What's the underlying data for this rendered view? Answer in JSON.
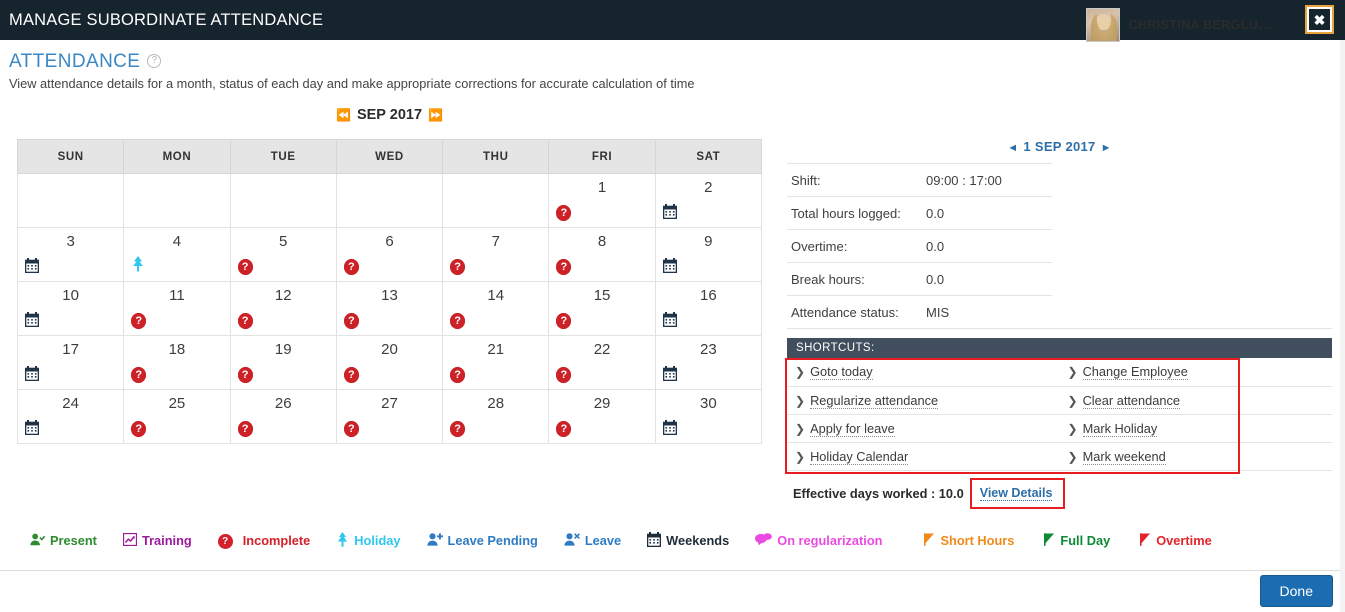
{
  "window": {
    "title": "MANAGE SUBORDINATE ATTENDANCE",
    "close_label": "✖"
  },
  "header": {
    "page_title": "ATTENDANCE",
    "help_icon": "?",
    "subtitle": "View attendance details for a month, status of each day and make appropriate corrections for accurate calculation of time",
    "user_name": "CHRISTINA BERGLU…"
  },
  "month_nav": {
    "prev": "⏪",
    "label": "SEP 2017",
    "next": "⏩"
  },
  "calendar": {
    "weekdays": [
      "SUN",
      "MON",
      "TUE",
      "WED",
      "THU",
      "FRI",
      "SAT"
    ],
    "weeks": [
      [
        {
          "day": "",
          "mark": ""
        },
        {
          "day": "",
          "mark": ""
        },
        {
          "day": "",
          "mark": ""
        },
        {
          "day": "",
          "mark": ""
        },
        {
          "day": "",
          "mark": ""
        },
        {
          "day": "1",
          "mark": "incomplete"
        },
        {
          "day": "2",
          "mark": "weekend"
        }
      ],
      [
        {
          "day": "3",
          "mark": "weekend"
        },
        {
          "day": "4",
          "mark": "holiday"
        },
        {
          "day": "5",
          "mark": "incomplete"
        },
        {
          "day": "6",
          "mark": "incomplete"
        },
        {
          "day": "7",
          "mark": "incomplete"
        },
        {
          "day": "8",
          "mark": "incomplete"
        },
        {
          "day": "9",
          "mark": "weekend"
        }
      ],
      [
        {
          "day": "10",
          "mark": "weekend"
        },
        {
          "day": "11",
          "mark": "incomplete"
        },
        {
          "day": "12",
          "mark": "incomplete"
        },
        {
          "day": "13",
          "mark": "incomplete"
        },
        {
          "day": "14",
          "mark": "incomplete"
        },
        {
          "day": "15",
          "mark": "incomplete"
        },
        {
          "day": "16",
          "mark": "weekend"
        }
      ],
      [
        {
          "day": "17",
          "mark": "weekend"
        },
        {
          "day": "18",
          "mark": "incomplete"
        },
        {
          "day": "19",
          "mark": "incomplete"
        },
        {
          "day": "20",
          "mark": "incomplete"
        },
        {
          "day": "21",
          "mark": "incomplete"
        },
        {
          "day": "22",
          "mark": "incomplete"
        },
        {
          "day": "23",
          "mark": "weekend"
        }
      ],
      [
        {
          "day": "24",
          "mark": "weekend"
        },
        {
          "day": "25",
          "mark": "incomplete"
        },
        {
          "day": "26",
          "mark": "incomplete"
        },
        {
          "day": "27",
          "mark": "incomplete"
        },
        {
          "day": "28",
          "mark": "incomplete"
        },
        {
          "day": "29",
          "mark": "incomplete"
        },
        {
          "day": "30",
          "mark": "weekend"
        }
      ]
    ]
  },
  "day_detail": {
    "prev": "◄",
    "date": "1 SEP 2017",
    "next": "►",
    "rows": [
      {
        "key": "Shift:",
        "value": "09:00 : 17:00"
      },
      {
        "key": "Total hours logged:",
        "value": "0.0"
      },
      {
        "key": "Overtime:",
        "value": "0.0"
      },
      {
        "key": "Break hours:",
        "value": "0.0"
      },
      {
        "key": "Attendance status:",
        "value": "MIS"
      }
    ]
  },
  "shortcuts": {
    "title": "SHORTCUTS:",
    "chevron": "❯",
    "rows": [
      {
        "left": "Goto today",
        "right": "Change Employee"
      },
      {
        "left": "Regularize attendance",
        "right": "Clear attendance"
      },
      {
        "left": "Apply for leave",
        "right": "Mark Holiday"
      },
      {
        "left": "Holiday Calendar",
        "right": "Mark weekend"
      }
    ]
  },
  "effective": {
    "text": "Effective days worked : 10.0",
    "view_details": "View Details"
  },
  "legend": [
    {
      "label": "Present",
      "icon": "person-check-icon",
      "glyph": "⚇",
      "class": "lg-present"
    },
    {
      "label": "Training",
      "icon": "chart-icon",
      "glyph": "↗",
      "class": "lg-training"
    },
    {
      "label": "Incomplete",
      "icon": "question-circle-icon",
      "glyph": "?",
      "class": "lg-incomplete"
    },
    {
      "label": "Holiday",
      "icon": "tree-icon",
      "glyph": "♣",
      "class": "lg-holiday"
    },
    {
      "label": "Leave Pending",
      "icon": "person-plus-icon",
      "glyph": "⚇",
      "class": "lg-leavepending"
    },
    {
      "label": "Leave",
      "icon": "person-x-icon",
      "glyph": "⚇",
      "class": "lg-leave"
    },
    {
      "label": "Weekends",
      "icon": "calendar-icon",
      "glyph": "Ὄ5",
      "class": "lg-weekends"
    },
    {
      "label": "On regularization",
      "icon": "chat-icon",
      "glyph": "●",
      "class": "lg-onreg"
    },
    {
      "label": "Short Hours",
      "icon": "flag-icon",
      "glyph": "⚑",
      "class": "lg-short"
    },
    {
      "label": "Full Day",
      "icon": "flag-icon",
      "glyph": "⚑",
      "class": "lg-full"
    },
    {
      "label": "Overtime",
      "icon": "flag-icon",
      "glyph": "⚑",
      "class": "lg-over"
    }
  ],
  "footer": {
    "done_label": "Done"
  },
  "colors": {
    "topbar": "#16242e",
    "accent_blue": "#3b87c4",
    "shortcuts_bar": "#414e5e",
    "highlight_red": "#e81d22",
    "incomplete_red": "#cc2127",
    "holiday_cyan": "#2ec7ef",
    "done_button": "#1b6cb0"
  }
}
